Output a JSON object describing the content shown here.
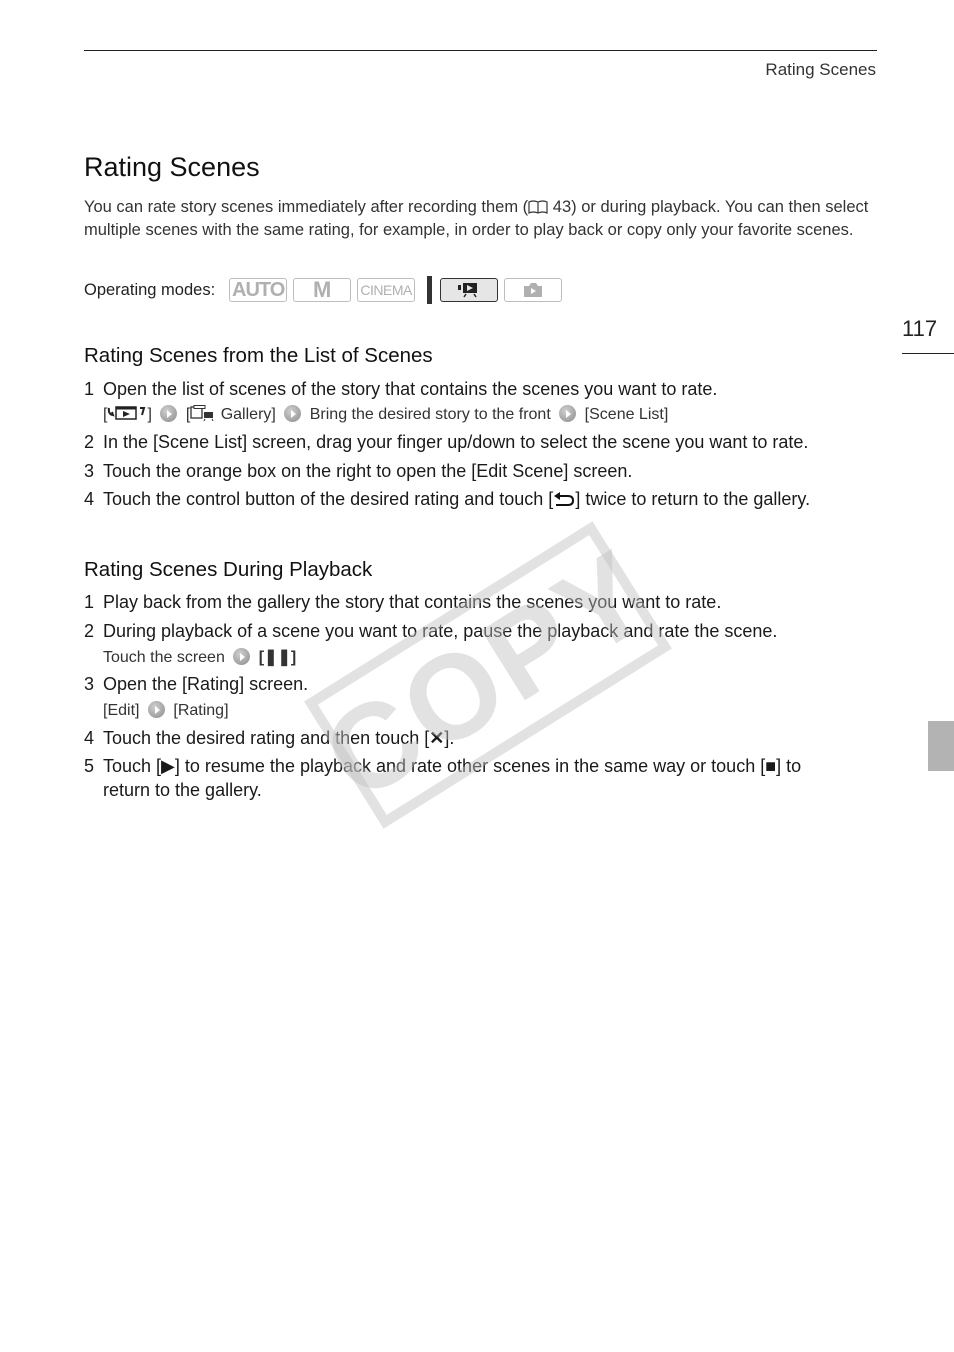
{
  "header": {
    "running_title": "Rating Scenes",
    "page_number": "117"
  },
  "title": "Rating Scenes",
  "intro": {
    "before_ref": "You can rate story scenes immediately after recording them (",
    "ref_page": "43",
    "after_ref": ") or during playback. You can then select multiple scenes with the same rating, for example, in order to play back or copy only your favorite scenes."
  },
  "operating_modes": {
    "label": "Operating modes:",
    "modes": [
      {
        "label": "AUTO",
        "active": false
      },
      {
        "label": "M",
        "active": false
      },
      {
        "label": "CINEMA",
        "active": false
      },
      {
        "label": "movie-playback-icon",
        "active": true
      },
      {
        "label": "photo-playback-icon",
        "active": false
      }
    ]
  },
  "section1": {
    "heading": "Rating Scenes from the List of Scenes",
    "steps": [
      {
        "num": "1",
        "text": "Open the list of scenes of the story that contains the scenes you want to rate."
      },
      {
        "num": "2",
        "text": "In the [Scene List] screen, drag your finger up/down to select the scene you want to rate."
      },
      {
        "num": "3",
        "text": "Touch the orange box on the right to open the [Edit Scene] screen."
      },
      {
        "num": "4",
        "text_before": "Touch the control button of the desired rating and touch [",
        "glyph": "⮌",
        "text_after": "] twice to return to the gallery."
      }
    ],
    "sub1": {
      "part1_open": "[",
      "part1_close": "]",
      "part2_open": "[",
      "part2_label": " Gallery]",
      "part3": "Bring the desired story to the front",
      "part4": "[Scene List]"
    }
  },
  "section2": {
    "heading": "Rating Scenes During Playback",
    "steps": [
      {
        "num": "1",
        "text": "Play back from the gallery the story that contains the scenes you want to rate."
      },
      {
        "num": "2",
        "text": "During playback of a scene you want to rate, pause the playback and rate the scene."
      },
      {
        "num": "3",
        "text": "Open the [Rating] screen."
      },
      {
        "num": "4",
        "text_before": "Touch the desired rating and then touch [",
        "glyph": "✕",
        "text_after": "]."
      },
      {
        "num": "5",
        "text_before": "Touch [",
        "glyph_play": "▶",
        "text_mid": "] to resume the playback and rate other scenes in the same way or touch [",
        "glyph_stop": "■",
        "text_after": "] to",
        "text_line2": "return to the gallery."
      }
    ],
    "sub2": {
      "before": "Touch the screen",
      "bracket": "[❚❚]"
    },
    "sub3": {
      "before": "[Edit]",
      "after": "[Rating]"
    }
  },
  "watermark": "COPY"
}
